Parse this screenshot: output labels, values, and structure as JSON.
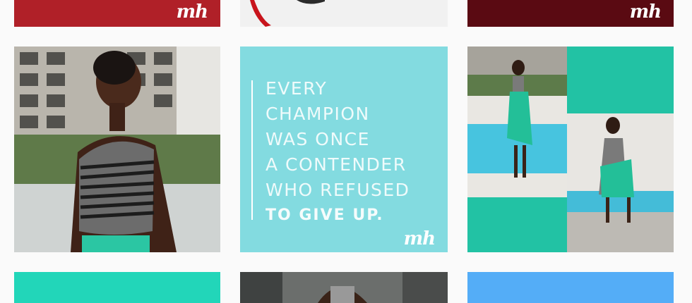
{
  "feed": {
    "tiles": [
      {
        "kind": "graphic",
        "logo": "mh"
      },
      {
        "kind": "photo"
      },
      {
        "kind": "graphic",
        "logo": "mh"
      },
      {
        "kind": "photo"
      },
      {
        "kind": "quote",
        "quote_lines": [
          "EVERY",
          "CHAMPION",
          "WAS ONCE",
          "A CONTENDER",
          "WHO REFUSED",
          "TO GIVE UP."
        ],
        "logo": "mh"
      },
      {
        "kind": "photo-collage"
      },
      {
        "kind": "graphic"
      },
      {
        "kind": "photo"
      },
      {
        "kind": "graphic"
      }
    ]
  },
  "colors": {
    "page_background": "#fafafa",
    "quote_tile": "#83dbe0",
    "teal": "#22c2a4",
    "red": "#b02028",
    "maroon": "#5a0a12",
    "blue": "#54adf7"
  }
}
